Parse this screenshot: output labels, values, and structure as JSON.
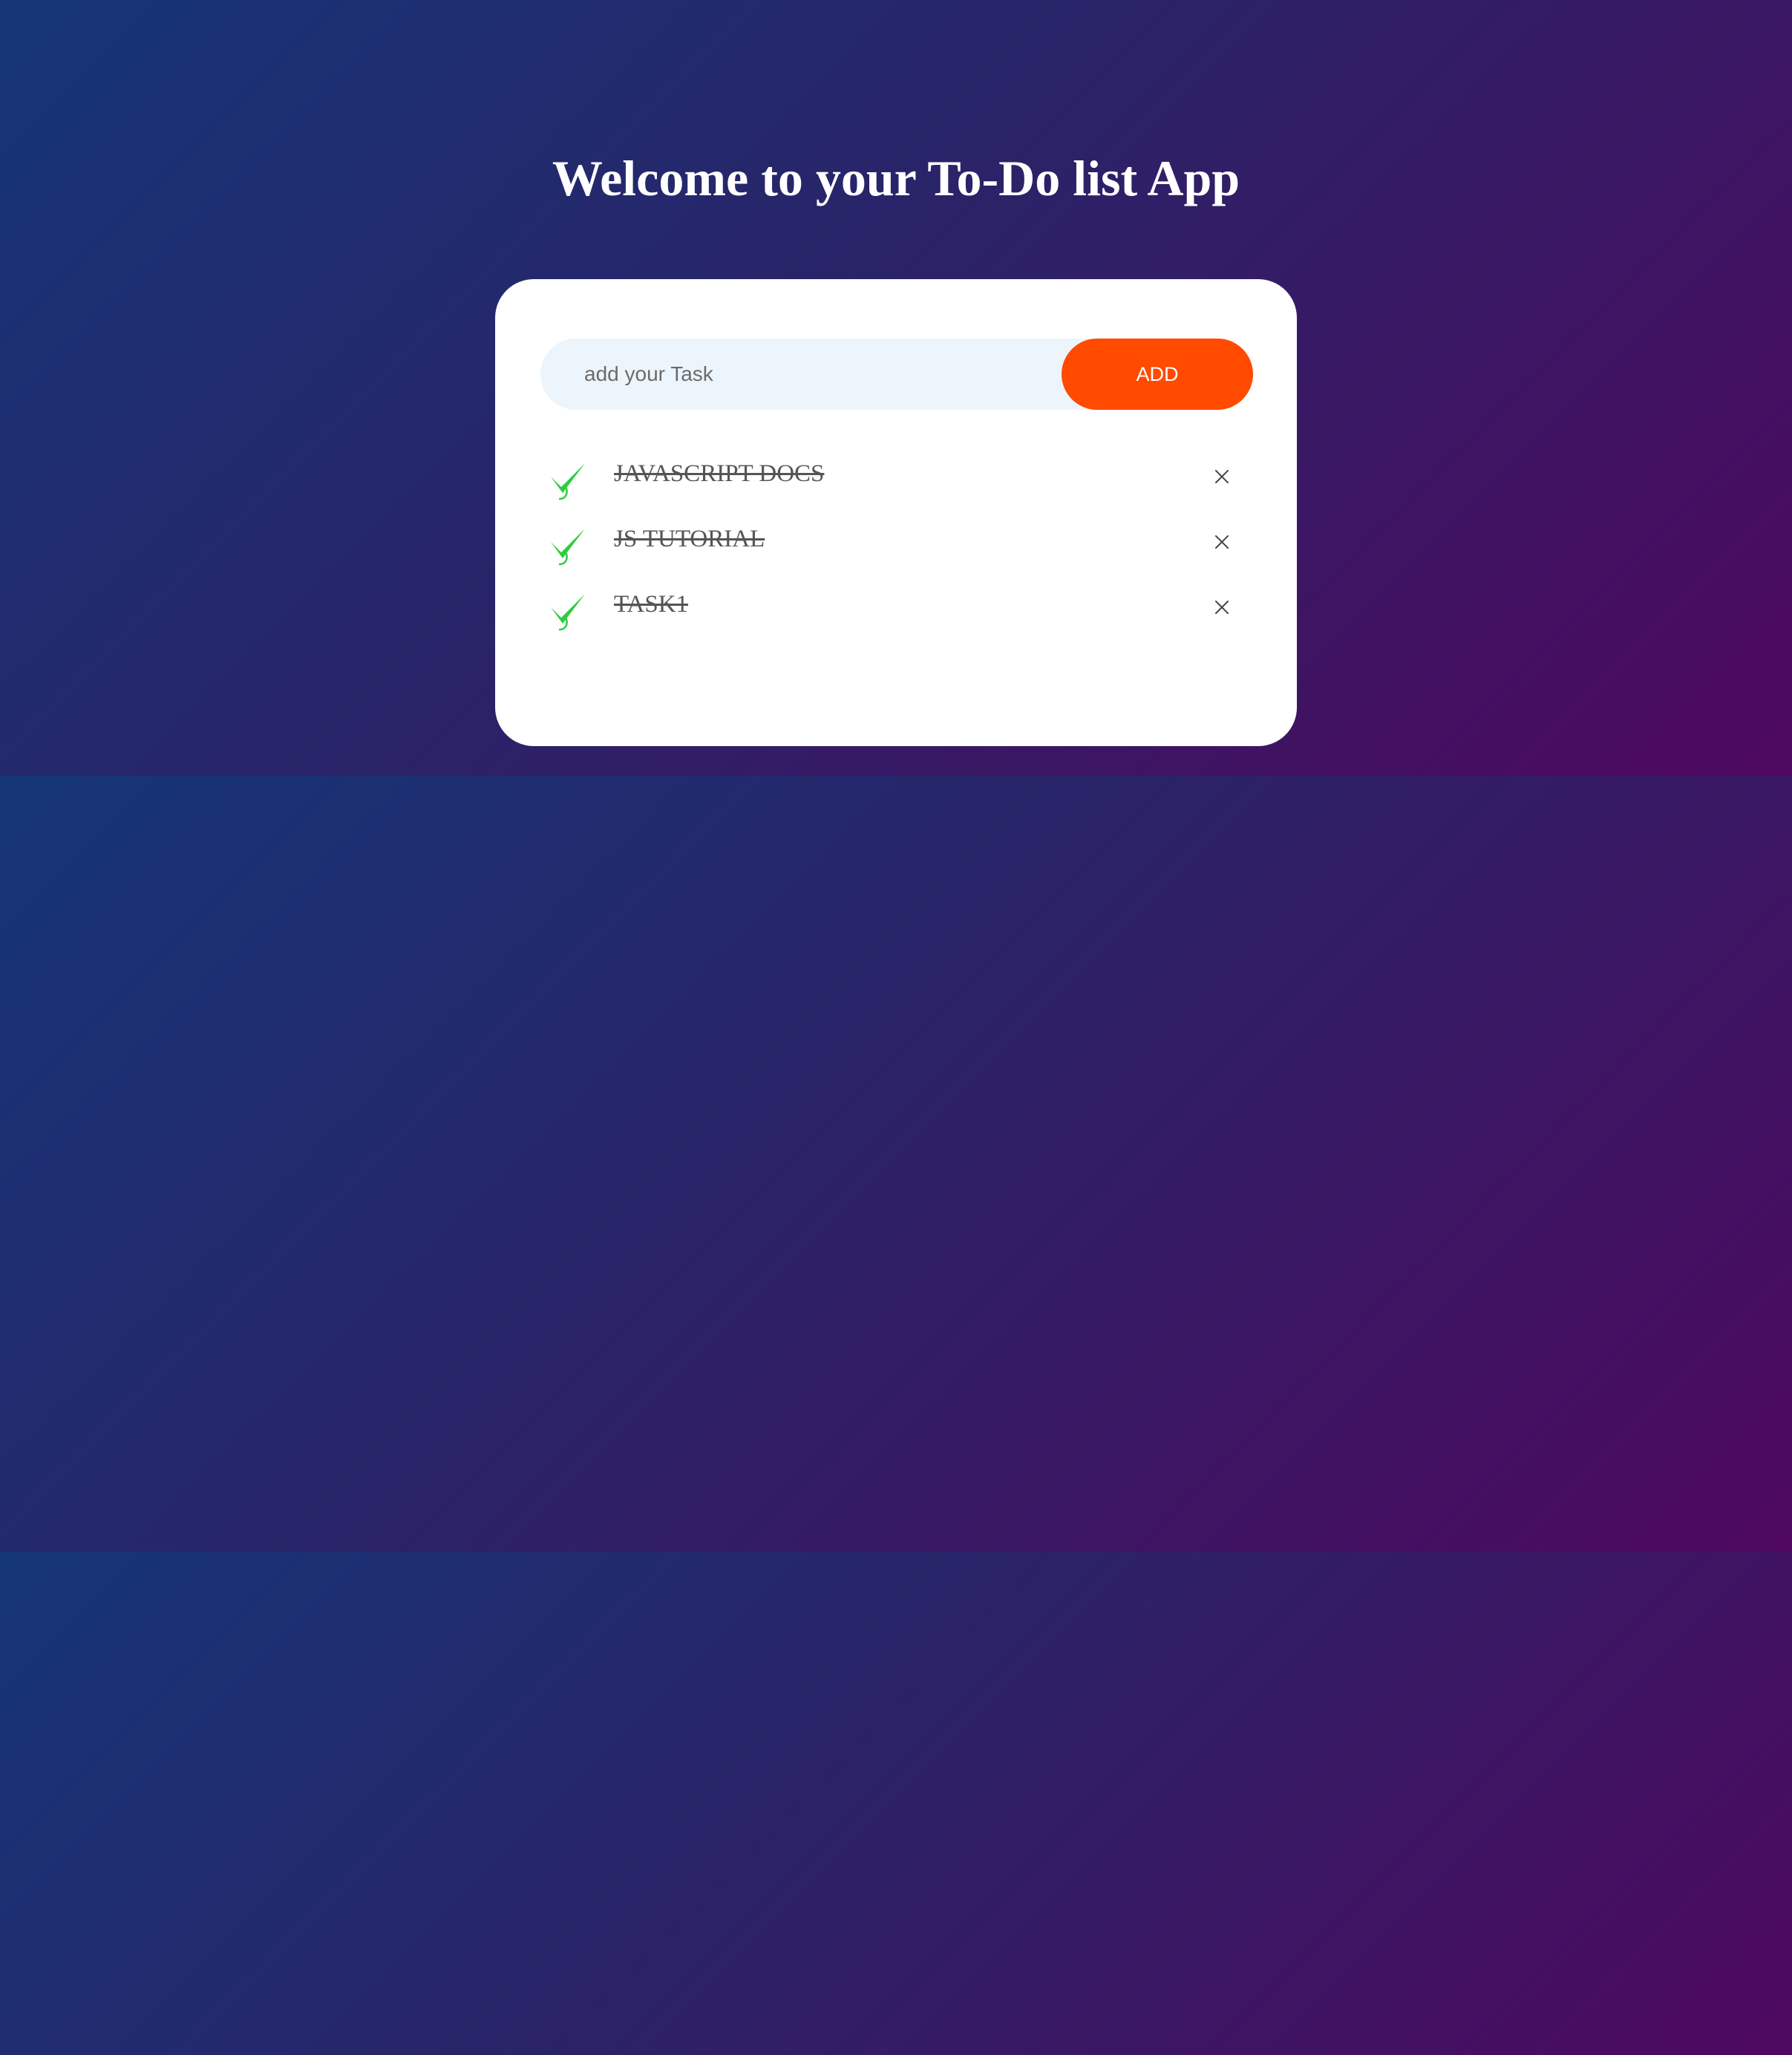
{
  "header": {
    "title": "Welcome to your To-Do list App"
  },
  "input": {
    "placeholder": "add your Task",
    "value": ""
  },
  "add_button": {
    "label": "ADD"
  },
  "tasks": [
    {
      "text": "JAVASCRIPT DOCS",
      "checked": true
    },
    {
      "text": "JS TUTORIAL",
      "checked": true
    },
    {
      "text": "TASK1",
      "checked": true
    }
  ],
  "colors": {
    "background_start": "#153677",
    "background_end": "#4e085f",
    "accent": "#ff4a00",
    "check": "#2ecc40",
    "input_bg": "#edf5fc"
  },
  "icons": {
    "check": "check-icon",
    "delete": "close-icon"
  }
}
